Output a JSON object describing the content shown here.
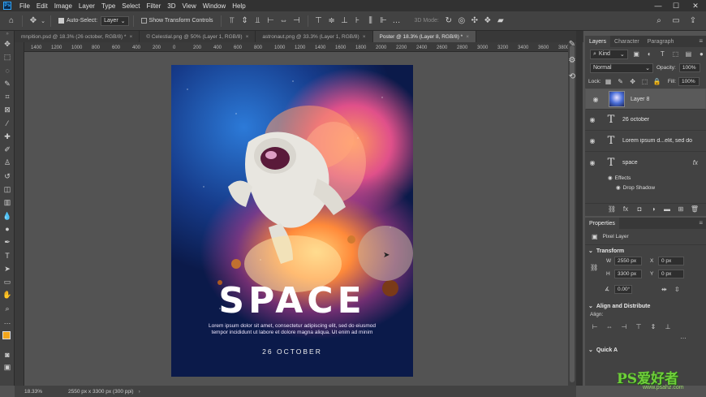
{
  "app": {
    "logo": "Ps"
  },
  "menu": [
    "File",
    "Edit",
    "Image",
    "Layer",
    "Type",
    "Select",
    "Filter",
    "3D",
    "View",
    "Window",
    "Help"
  ],
  "window_controls": [
    "—",
    "☐",
    "✕"
  ],
  "options": {
    "auto_select_label": "Auto-Select:",
    "auto_select_value": "Layer",
    "transform_controls_label": "Show Transform Controls",
    "mode_3d_label": "3D Mode:"
  },
  "tabs": [
    {
      "label": "mnpition.psd @ 18.3% (26 october, RGB/8) *",
      "active": false
    },
    {
      "label": "© Celestial.png @ 50% (Layer 1, RGB/8)",
      "active": false
    },
    {
      "label": "astronaut.png @ 33.3% (Layer 1, RGB/8)",
      "active": false
    },
    {
      "label": "Poster @ 18.3% (Layer 8, RGB/8) *",
      "active": true
    }
  ],
  "ruler_ticks": [
    "1400",
    "1200",
    "1000",
    "800",
    "600",
    "400",
    "200",
    "0",
    "200",
    "400",
    "600",
    "800",
    "1000",
    "1200",
    "1400",
    "1600",
    "1800",
    "2000",
    "2200",
    "2400",
    "2600",
    "2800",
    "3000",
    "3200",
    "3400",
    "3600",
    "3800"
  ],
  "poster": {
    "title": "SPACE",
    "body": "Lorem ipsum dolor sit amet, consectetur adipiscing elit, sed do eiusmod tempor incididunt ut labore et dolore magna aliqua. Ut enim ad minim",
    "date": "26 OCTOBER"
  },
  "status": {
    "zoom": "18.33%",
    "doc_info": "2550 px x 3300 px (300 ppi)"
  },
  "layers_panel": {
    "tabs": [
      "Layers",
      "Character",
      "Paragraph"
    ],
    "kind_label": "Kind",
    "blend_mode": "Normal",
    "opacity_label": "Opacity:",
    "opacity_value": "100%",
    "lock_label": "Lock:",
    "fill_label": "Fill:",
    "fill_value": "100%",
    "layers": [
      {
        "name": "Layer 8",
        "type": "image",
        "selected": true
      },
      {
        "name": "26 october",
        "type": "text",
        "selected": false
      },
      {
        "name": "Lorem ipsum d...elit, sed do",
        "type": "text",
        "selected": false
      },
      {
        "name": "space",
        "type": "text",
        "selected": false,
        "fx": "fx"
      }
    ],
    "effects_label": "Effects",
    "drop_shadow_label": "Drop Shadow"
  },
  "properties_panel": {
    "title": "Properties",
    "pixel_layer_label": "Pixel Layer",
    "transform_label": "Transform",
    "w_label": "W",
    "w_value": "2550 px",
    "h_label": "H",
    "h_value": "3300 px",
    "x_label": "X",
    "x_value": "0 px",
    "y_label": "Y",
    "y_value": "0 px",
    "angle_value": "0.00°",
    "align_label": "Align and Distribute",
    "align_sub": "Align:",
    "quick_actions_label": "Quick A"
  },
  "watermark": {
    "text": "PS爱好者",
    "url": "www.psahz.com"
  }
}
